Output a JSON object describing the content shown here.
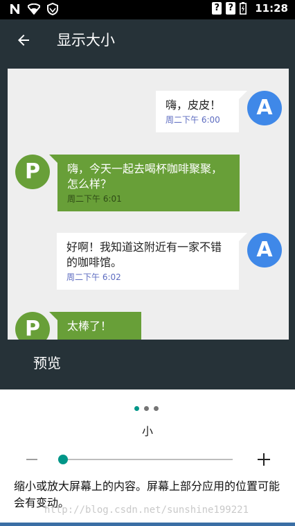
{
  "status_bar": {
    "icons": [
      "notification-n-icon",
      "wifi-icon",
      "vpn-shield-icon",
      "unknown-sim-icon",
      "unknown-sim-icon",
      "battery-icon"
    ],
    "unknown_glyph": "?",
    "time": "11:28"
  },
  "app_bar": {
    "title": "显示大小",
    "back_icon": "arrow-back-icon"
  },
  "chat": {
    "messages": [
      {
        "from": "A",
        "text": "嗨，皮皮！",
        "time": "周二下午 6:00"
      },
      {
        "from": "P",
        "text": "嗨，今天一起去喝杯咖啡聚聚，怎么样？",
        "time": "周二下午 6:01"
      },
      {
        "from": "A",
        "text": "好啊！我知道这附近有一家不错的咖啡馆。",
        "time": "周二下午 6:02"
      },
      {
        "from": "P",
        "text": "太棒了！",
        "time": ""
      }
    ]
  },
  "preview_label": "预览",
  "pager": {
    "count": 3,
    "active": 0
  },
  "size_label": "小",
  "slider": {
    "value_index": 0,
    "min_icon": "minus-icon",
    "max_icon": "plus-icon"
  },
  "description": "缩小或放大屏幕上的内容。屏幕上部分应用的位置可能会有变动。",
  "watermark": "http://blog.csdn.net/sunshine199221",
  "colors": {
    "app_bar": "#263238",
    "accent": "#009688",
    "avatar_a": "#3f88e8",
    "bubble_green": "#689f38"
  }
}
